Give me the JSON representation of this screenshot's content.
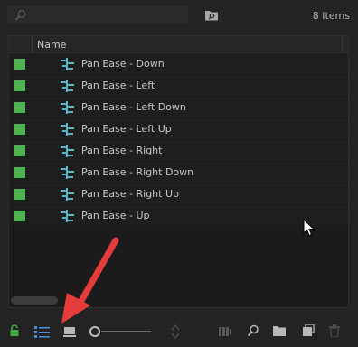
{
  "toolbar": {
    "search_placeholder": "",
    "item_count": "8 Items"
  },
  "list": {
    "column_name": "Name",
    "items": [
      {
        "label": "Pan Ease - Down"
      },
      {
        "label": "Pan Ease - Left"
      },
      {
        "label": "Pan Ease - Left Down"
      },
      {
        "label": "Pan Ease - Left Up"
      },
      {
        "label": "Pan Ease - Right"
      },
      {
        "label": "Pan Ease - Right Down"
      },
      {
        "label": "Pan Ease - Right Up"
      },
      {
        "label": "Pan Ease - Up"
      }
    ]
  },
  "colors": {
    "label_green": "#4fb04f",
    "lock_green": "#3fae3f",
    "list_view_blue": "#4a90d9",
    "annotation_arrow": "#e43b3b"
  },
  "icons": {
    "search": "search-icon",
    "new_bin": "new-bin-icon",
    "sequence": "sequence-icon",
    "lock": "lock-icon",
    "list_view": "list-view-icon",
    "icon_view": "icon-view-icon",
    "sort": "sort-icon",
    "automate": "automate-to-sequence-icon",
    "find": "find-icon",
    "folder": "new-bin-icon",
    "new_item": "new-item-icon",
    "clear": "trash-icon"
  }
}
